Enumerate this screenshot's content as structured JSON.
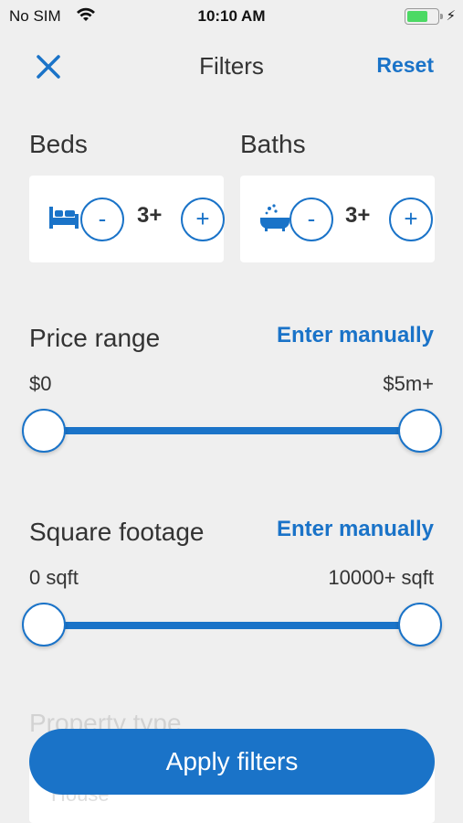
{
  "status_bar": {
    "carrier": "No SIM",
    "time": "10:10 AM",
    "battery_level": 0.7
  },
  "nav": {
    "title": "Filters",
    "reset_label": "Reset",
    "close_icon": "close-icon"
  },
  "beds": {
    "label": "Beds",
    "value": "3+",
    "minus": "-",
    "plus": "+",
    "icon": "bed-icon"
  },
  "baths": {
    "label": "Baths",
    "value": "3+",
    "minus": "-",
    "plus": "+",
    "icon": "bathtub-icon"
  },
  "price": {
    "label": "Price range",
    "manual_label": "Enter manually",
    "min_label": "$0",
    "max_label": "$5m+"
  },
  "sqft": {
    "label": "Square footage",
    "manual_label": "Enter manually",
    "min_label": "0 sqft",
    "max_label": "10000+ sqft"
  },
  "property_type": {
    "label": "Property type",
    "first_option": "House"
  },
  "apply_label": "Apply filters",
  "colors": {
    "accent": "#1a73c8",
    "background": "#efefef",
    "battery": "#4cd964"
  }
}
